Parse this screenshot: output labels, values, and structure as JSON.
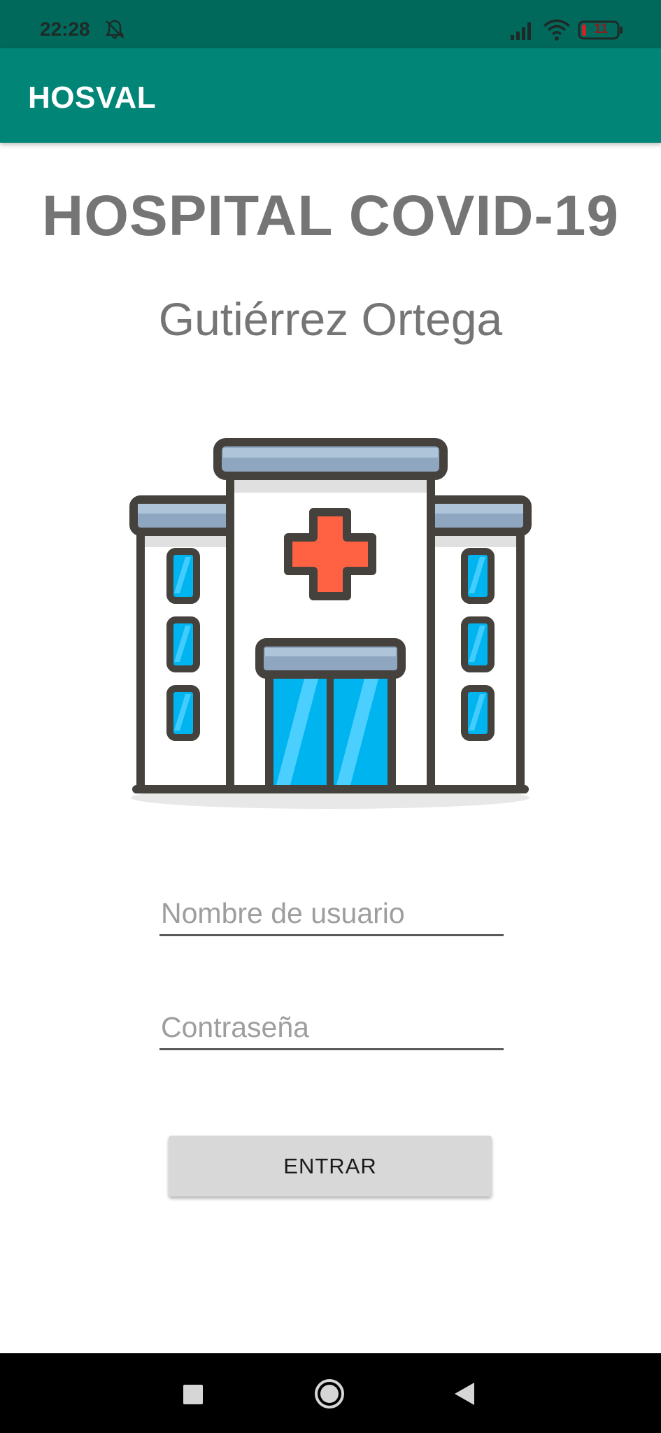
{
  "status_bar": {
    "time": "22:28",
    "battery_level": "11",
    "icons": [
      "bell-off-icon",
      "signal-icon",
      "wifi-icon",
      "battery-icon"
    ]
  },
  "app_bar": {
    "title": "HOSVAL"
  },
  "main": {
    "title": "HOSPITAL COVID-19",
    "subtitle": "Gutiérrez Ortega",
    "illustration": "hospital-icon",
    "username_placeholder": "Nombre de usuario",
    "password_placeholder": "Contraseña",
    "login_button": "ENTRAR"
  },
  "nav_bar": {
    "icons": [
      "recent-apps-icon",
      "home-icon",
      "back-icon"
    ]
  },
  "colors": {
    "status_bar": "#01695c",
    "app_bar": "#008577",
    "title_gray": "#757575",
    "button_gray": "#d8d8d8",
    "cross_red": "#ff6242",
    "window_blue": "#00b4f0"
  }
}
